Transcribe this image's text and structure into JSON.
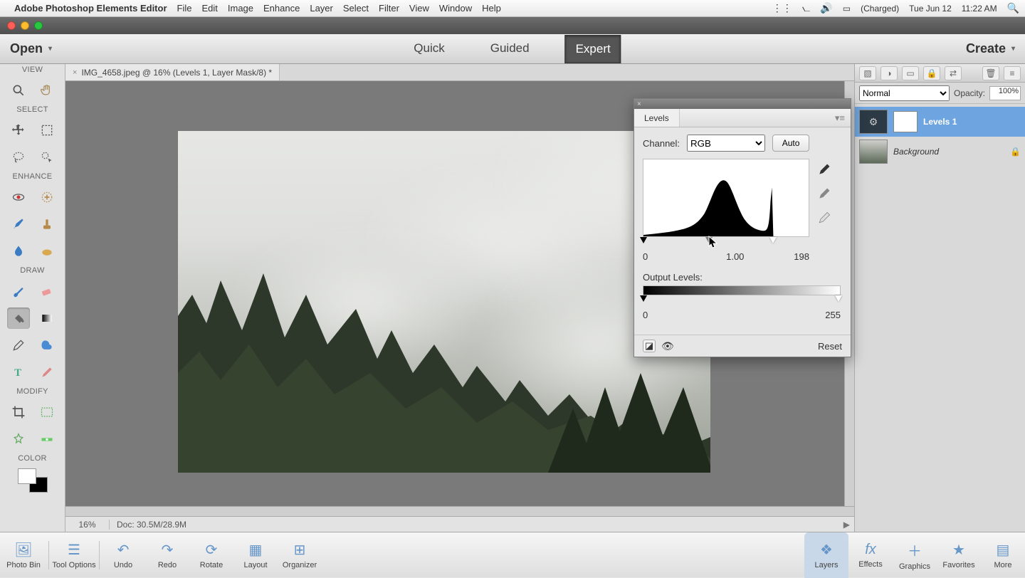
{
  "menubar": {
    "apple": "",
    "app_title": "Adobe Photoshop Elements Editor",
    "menus": [
      "File",
      "Edit",
      "Image",
      "Enhance",
      "Layer",
      "Select",
      "Filter",
      "View",
      "Window",
      "Help"
    ],
    "battery": "(Charged)",
    "date": "Tue Jun 12",
    "time": "11:22 AM"
  },
  "app_bar": {
    "open": "Open",
    "tabs": {
      "quick": "Quick",
      "guided": "Guided",
      "expert": "Expert"
    },
    "create": "Create"
  },
  "toolbox": {
    "view": "VIEW",
    "select": "SELECT",
    "enhance": "ENHANCE",
    "draw": "DRAW",
    "modify": "MODIFY",
    "color": "COLOR"
  },
  "document": {
    "tab_title": "IMG_4658.jpeg @ 16% (Levels 1, Layer Mask/8) *",
    "zoom": "16%",
    "docinfo": "Doc: 30.5M/28.9M"
  },
  "layers_panel": {
    "blend_mode": "Normal",
    "opacity_label": "Opacity:",
    "opacity_value": "100%",
    "layer_levels": "Levels 1",
    "layer_bg": "Background"
  },
  "levels": {
    "title": "Levels",
    "channel_label": "Channel:",
    "channel_value": "RGB",
    "auto": "Auto",
    "in_black": "0",
    "in_gamma": "1.00",
    "in_white": "198",
    "output_label": "Output Levels:",
    "out_black": "0",
    "out_white": "255",
    "reset": "Reset"
  },
  "bottom": {
    "photo_bin": "Photo Bin",
    "tool_options": "Tool Options",
    "undo": "Undo",
    "redo": "Redo",
    "rotate": "Rotate",
    "layout": "Layout",
    "organizer": "Organizer",
    "layers": "Layers",
    "effects": "Effects",
    "graphics": "Graphics",
    "favorites": "Favorites",
    "more": "More"
  }
}
